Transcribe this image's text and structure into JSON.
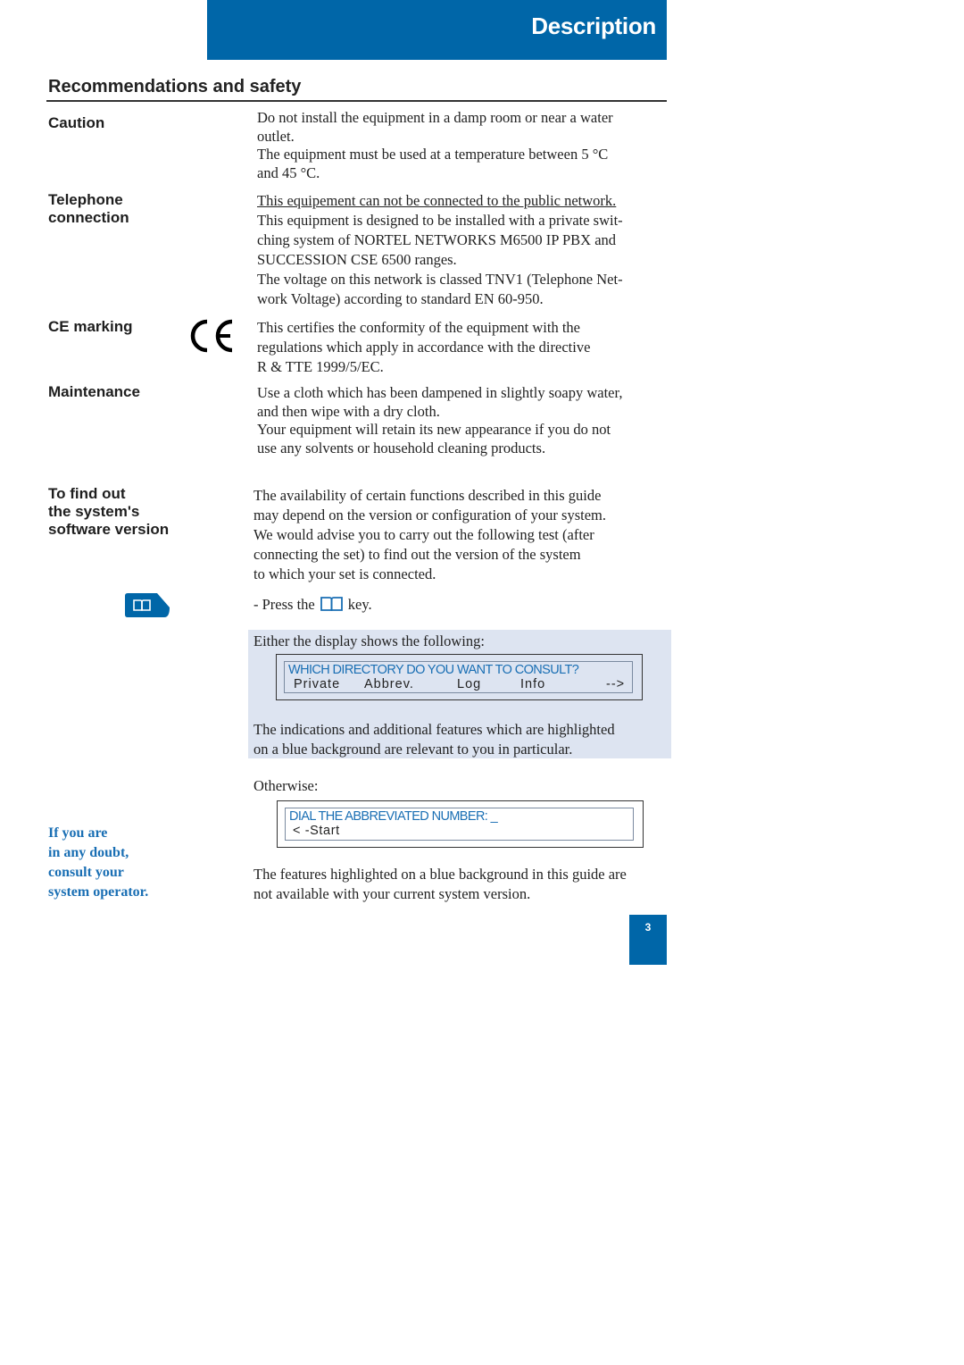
{
  "header": {
    "title": "Description",
    "accent_color": "#0066a8"
  },
  "section": {
    "title": "Recommendations and safety"
  },
  "caution": {
    "label": "Caution",
    "lines": [
      "Do not install the equipment in a damp room or near a water",
      "outlet.",
      "The equipment must be used at a temperature between 5 °C",
      "and 45 °C."
    ]
  },
  "telephone_connection": {
    "label_line1": "Telephone",
    "label_line2": "connection",
    "underlined_line": "This equipement can not be connected to the public network.",
    "lines": [
      "This equipment is designed to be installed with a private swit-",
      "ching system of NORTEL NETWORKS M6500 IP PBX and",
      "SUCCESSION CSE 6500 ranges.",
      "The voltage on this network is classed TNV1 (Telephone Net-",
      "work Voltage) according to standard EN 60-950."
    ]
  },
  "ce_marking": {
    "label": "CE marking",
    "icon": "ce-mark-icon",
    "lines": [
      "This certifies the conformity of the equipment with the",
      "regulations which apply in accordance with the directive",
      "R & TTE 1999/5/EC."
    ]
  },
  "maintenance": {
    "label": "Maintenance",
    "lines": [
      "Use a cloth which has been dampened in slightly soapy water,",
      "and then wipe with a dry cloth.",
      "Your equipment will retain its new appearance if you do not",
      "use any solvents or household cleaning products."
    ]
  },
  "software_version": {
    "label_line1": "To find out",
    "label_line2": "the system's",
    "label_line3": "software version",
    "lines": [
      "The availability of certain functions described in this guide",
      "may depend on the version or configuration of your system.",
      "We would advise you to carry out the following test (after",
      "connecting the set) to find out the version of the system",
      "to which your set is connected."
    ],
    "key_icon": "directory-book-icon",
    "press_prefix": "- Press the",
    "press_suffix": "key."
  },
  "highlight": {
    "background_color": "#dde4f1",
    "intro": "Either the display shows the following:",
    "screen": {
      "title": "WHICH DIRECTORY DO YOU WANT TO CONSULT?",
      "options": [
        "Private",
        "Abbrev.",
        "Log",
        "Info",
        "-->"
      ]
    },
    "note_lines": [
      "The indications and additional features which are highlighted",
      "on a blue background are relevant to you in particular."
    ]
  },
  "otherwise": {
    "intro": "Otherwise:",
    "screen": {
      "title": "DIAL THE ABBREVIATED NUMBER: _",
      "option": "< -Start"
    },
    "note_lines": [
      "The features highlighted on a blue background in this guide are",
      "not available with your current system version."
    ]
  },
  "doubt_note": {
    "lines": [
      "If you are",
      "in any doubt,",
      "consult your",
      "system operator."
    ],
    "color": "#1a6fb4"
  },
  "footer": {
    "page_number": "3"
  }
}
